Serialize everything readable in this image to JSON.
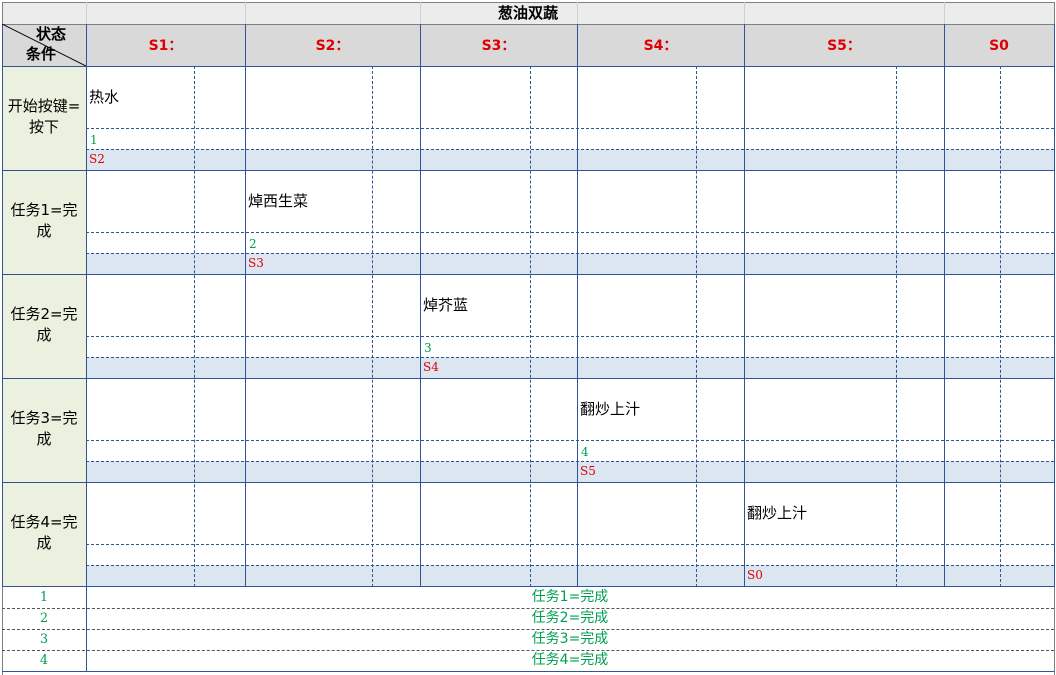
{
  "title": "葱油双蔬",
  "corner": {
    "top": "状态",
    "bottom": "条件"
  },
  "columns": [
    "S1：",
    "S2：",
    "S3：",
    "S4：",
    "S5：",
    "S0"
  ],
  "rows": [
    {
      "label": "开始按键=按下",
      "action": "热水",
      "num": "1",
      "next": "S2",
      "col": 0
    },
    {
      "label": "任务1=完成",
      "action": "焯西生菜",
      "num": "2",
      "next": "S3",
      "col": 1
    },
    {
      "label": "任务2=完成",
      "action": "焯芥蓝",
      "num": "3",
      "next": "S4",
      "col": 2
    },
    {
      "label": "任务3=完成",
      "action": "翻炒上汁",
      "num": "4",
      "next": "S5",
      "col": 3
    },
    {
      "label": "任务4=完成",
      "action": "翻炒上汁",
      "num": "",
      "next": "S0",
      "col": 4
    }
  ],
  "legend": [
    {
      "num": "1",
      "text": "任务1=完成"
    },
    {
      "num": "2",
      "text": "任务2=完成"
    },
    {
      "num": "3",
      "text": "任务3=完成"
    },
    {
      "num": "4",
      "text": "任务4=完成"
    }
  ],
  "colors": {
    "grid": "#2f5597",
    "header_bg": "#d9d9d9",
    "label_bg": "#ebf1de",
    "state_band": "#dce6f1",
    "green": "#00a050",
    "red": "#e00000"
  }
}
